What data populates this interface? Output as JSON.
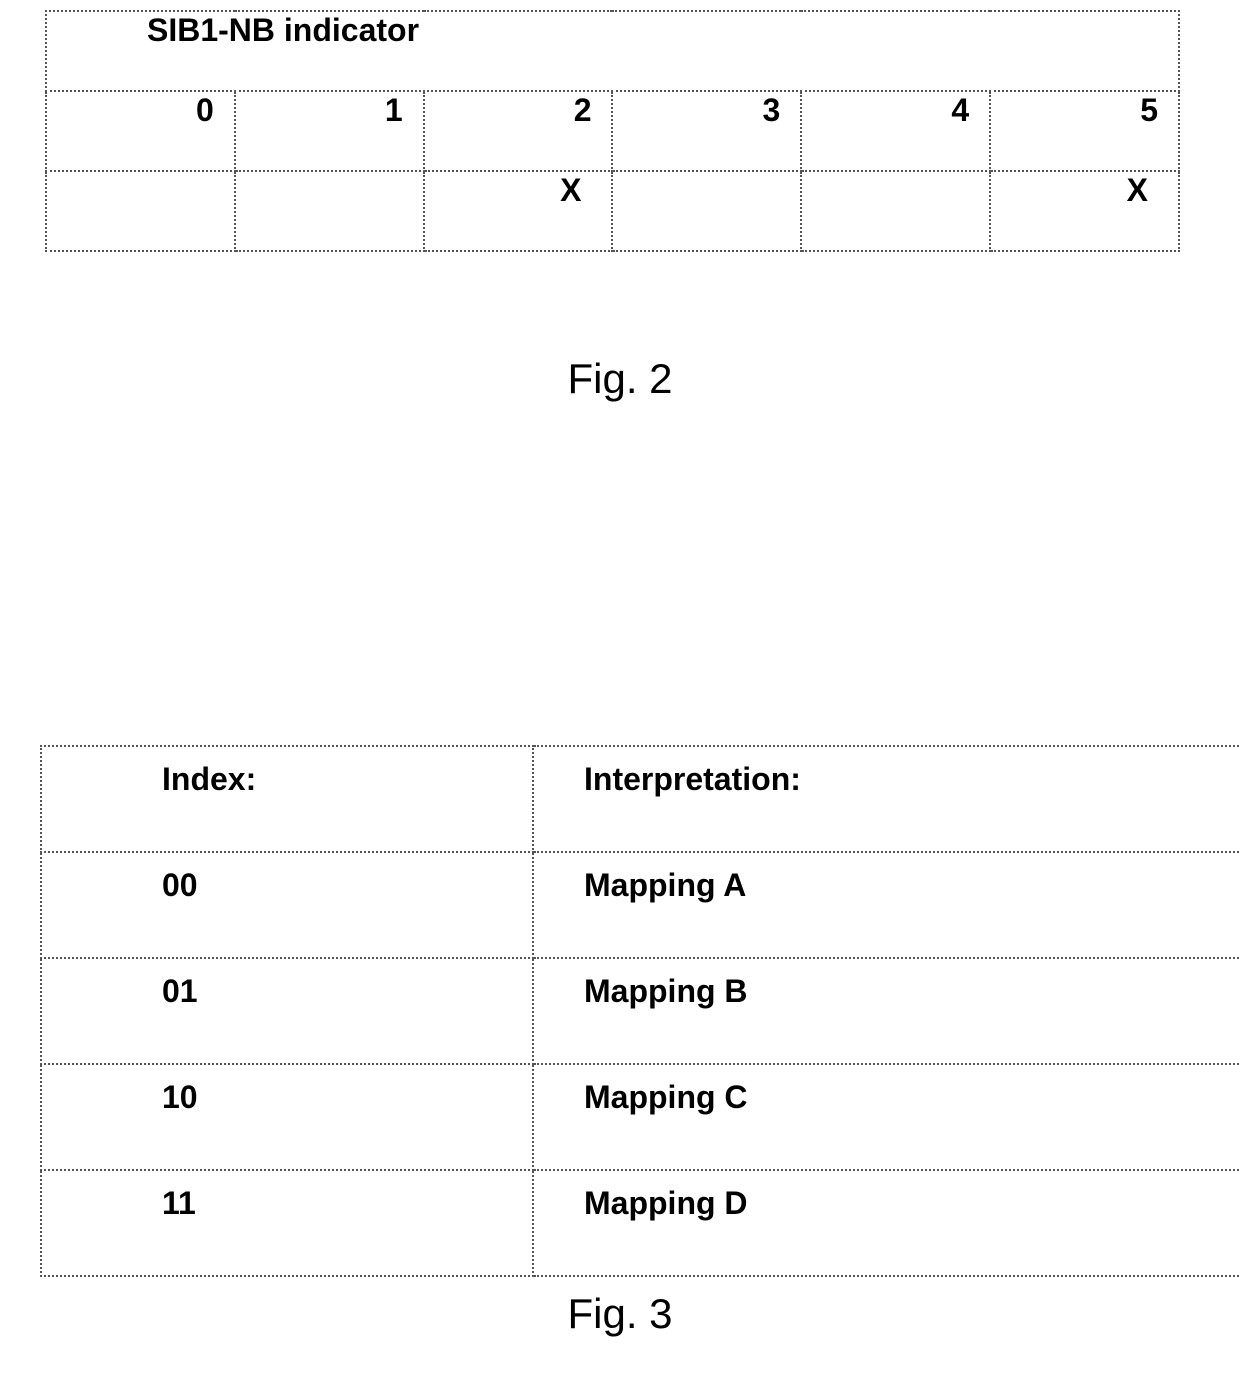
{
  "fig2": {
    "header": "SIB1-NB indicator",
    "cols": [
      "0",
      "1",
      "2",
      "3",
      "4",
      "5"
    ],
    "marks": [
      "",
      "",
      "X",
      "",
      "",
      "X"
    ],
    "caption": "Fig. 2"
  },
  "fig3": {
    "head_index": "Index:",
    "head_interp": "Interpretation:",
    "rows": [
      {
        "index": "00",
        "interp": "Mapping A"
      },
      {
        "index": "01",
        "interp": "Mapping B"
      },
      {
        "index": "10",
        "interp": "Mapping C"
      },
      {
        "index": "11",
        "interp": "Mapping D"
      }
    ],
    "caption": "Fig. 3"
  },
  "chart_data": [
    {
      "type": "table",
      "title": "SIB1-NB indicator",
      "columns": [
        "0",
        "1",
        "2",
        "3",
        "4",
        "5"
      ],
      "rows": [
        [
          "",
          "",
          "X",
          "",
          "",
          "X"
        ]
      ]
    },
    {
      "type": "table",
      "columns": [
        "Index:",
        "Interpretation:"
      ],
      "rows": [
        [
          "00",
          "Mapping A"
        ],
        [
          "01",
          "Mapping B"
        ],
        [
          "10",
          "Mapping C"
        ],
        [
          "11",
          "Mapping D"
        ]
      ]
    }
  ]
}
